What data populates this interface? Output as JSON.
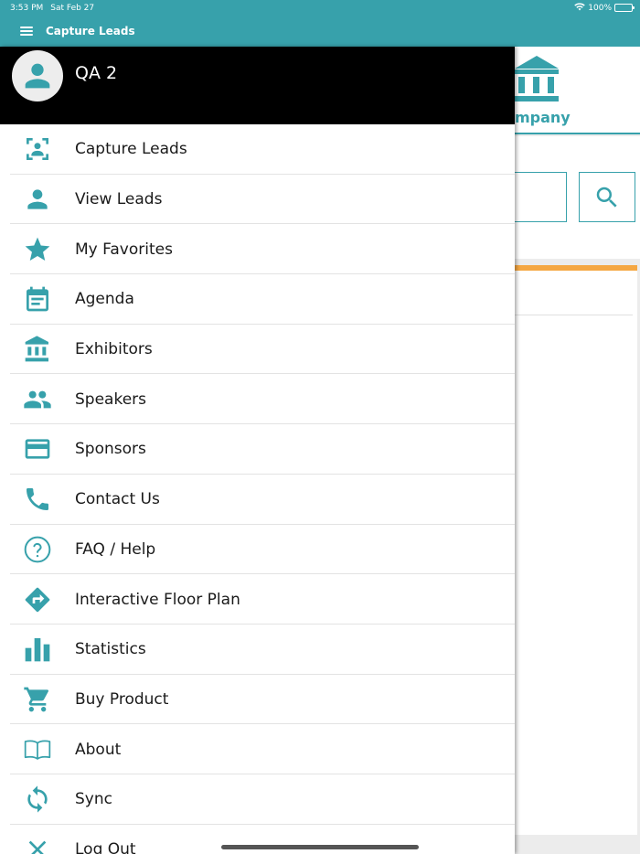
{
  "status_bar": {
    "time": "3:53 PM",
    "date": "Sat Feb 27",
    "battery": "100%",
    "icons": [
      "wifi-icon",
      "battery-icon"
    ]
  },
  "app_bar": {
    "title": "Capture Leads",
    "icon": "menu-icon"
  },
  "background": {
    "logo_text": "ompany",
    "logo_icon": "bank-icon",
    "search_icon": "search-icon",
    "accent": "#37a1ab",
    "card_accent": "#f5a742"
  },
  "drawer": {
    "user_name": "QA 2",
    "avatar_icon": "user-avatar-icon",
    "items": [
      {
        "label": "Capture Leads",
        "icon": "scan-user-icon"
      },
      {
        "label": "View Leads",
        "icon": "person-icon"
      },
      {
        "label": "My Favorites",
        "icon": "star-icon"
      },
      {
        "label": "Agenda",
        "icon": "calendar-icon"
      },
      {
        "label": "Exhibitors",
        "icon": "bank-icon"
      },
      {
        "label": "Speakers",
        "icon": "people-icon"
      },
      {
        "label": "Sponsors",
        "icon": "credit-card-icon"
      },
      {
        "label": "Contact Us",
        "icon": "phone-icon"
      },
      {
        "label": "FAQ / Help",
        "icon": "help-circle-icon"
      },
      {
        "label": "Interactive Floor Plan",
        "icon": "directions-icon"
      },
      {
        "label": "Statistics",
        "icon": "bar-chart-icon"
      },
      {
        "label": "Buy Product",
        "icon": "cart-icon"
      },
      {
        "label": "About",
        "icon": "book-icon"
      },
      {
        "label": "Sync",
        "icon": "sync-icon"
      },
      {
        "label": "Log Out",
        "icon": "close-icon"
      }
    ]
  },
  "colors": {
    "primary": "#37a1ab",
    "header_bg": "#000000"
  }
}
